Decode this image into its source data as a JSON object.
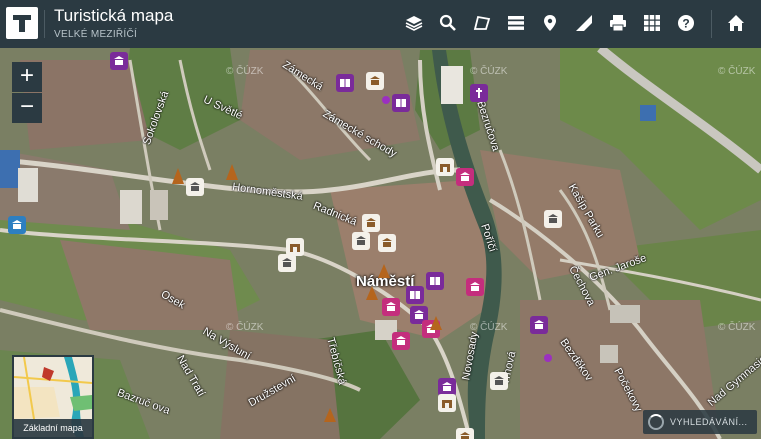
{
  "app": {
    "title": "Turistická mapa",
    "subtitle": "VELKÉ MEZIŘÍČÍ"
  },
  "toolbar": [
    {
      "name": "layers-icon",
      "label": "Vrstvy"
    },
    {
      "name": "search-icon",
      "label": "Hledat"
    },
    {
      "name": "area-icon",
      "label": "Plocha"
    },
    {
      "name": "list-icon",
      "label": "Seznam"
    },
    {
      "name": "location-pin-icon",
      "label": "Místo"
    },
    {
      "name": "measure-icon",
      "label": "Měření"
    },
    {
      "name": "print-icon",
      "label": "Tisk"
    },
    {
      "name": "grid-icon",
      "label": "Aplikace"
    },
    {
      "name": "help-icon",
      "label": "Nápověda"
    },
    {
      "name": "home-icon",
      "label": "Domů"
    }
  ],
  "zoom": {
    "in": "+",
    "out": "−"
  },
  "basemap": {
    "label": "Základní mapa"
  },
  "search_status": "VYHLEDÁVÁNÍ...",
  "map_labels": {
    "square": "Náměstí",
    "streets": [
      "Hornoměstská",
      "Radnická",
      "Zámecká",
      "Zámecké schody",
      "Sokolovská",
      "U Světlé",
      "Bezručova",
      "Poříčí",
      "Novosady",
      "Trhová",
      "Třebíčská",
      "Družstevní",
      "Bazruč ova",
      "Nad Tratí",
      "Na Výsluní",
      "Kašíp Parku",
      "Gen. Jaroše",
      "Čechova",
      "Bezděkov",
      "Počekovy",
      "Nad Gymnasiem",
      "Osek"
    ],
    "copyright": "© ČÚZK"
  }
}
